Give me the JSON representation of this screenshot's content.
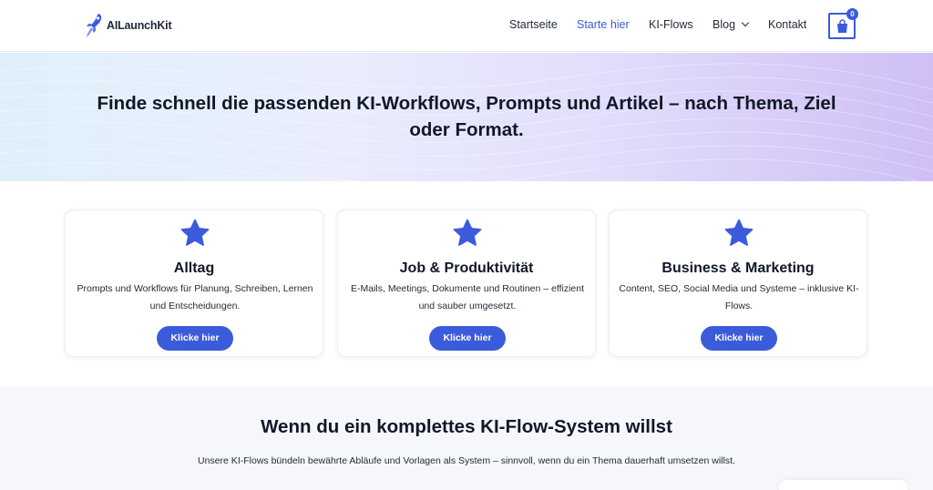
{
  "brand": {
    "name": "AILaunchKit"
  },
  "nav": {
    "items": [
      {
        "label": "Startseite",
        "active": false
      },
      {
        "label": "Starte hier",
        "active": true
      },
      {
        "label": "KI-Flows",
        "active": false
      },
      {
        "label": "Blog",
        "active": false,
        "dropdown": true
      },
      {
        "label": "Kontakt",
        "active": false
      }
    ],
    "cart_count": "0"
  },
  "hero": {
    "title": "Finde schnell die passenden KI-Workflows, Prompts und Artikel – nach Thema, Ziel oder Format."
  },
  "cards": [
    {
      "icon": "star-icon",
      "title": "Alltag",
      "description": "Prompts und Workflows für Planung, Schreiben, Lernen und Entscheidungen.",
      "button": "Klicke hier"
    },
    {
      "icon": "star-icon",
      "title": "Job & Produktivität",
      "description": "E-Mails, Meetings, Dokumente und Routinen – effizient und sauber umgesetzt.",
      "button": "Klicke hier"
    },
    {
      "icon": "star-icon",
      "title": "Business & Marketing",
      "description": "Content, SEO, Social Media und Systeme – inklusive KI-Flows.",
      "button": "Klicke hier"
    }
  ],
  "system": {
    "title": "Wenn du ein komplettes KI-Flow-System willst",
    "description": "Unsere KI-Flows bündeln bewährte Abläufe und Vorlagen als System – sinnvoll, wenn du ein Thema dauerhaft umsetzen willst."
  },
  "colors": {
    "accent": "#3b5bdb",
    "text": "#111827"
  }
}
